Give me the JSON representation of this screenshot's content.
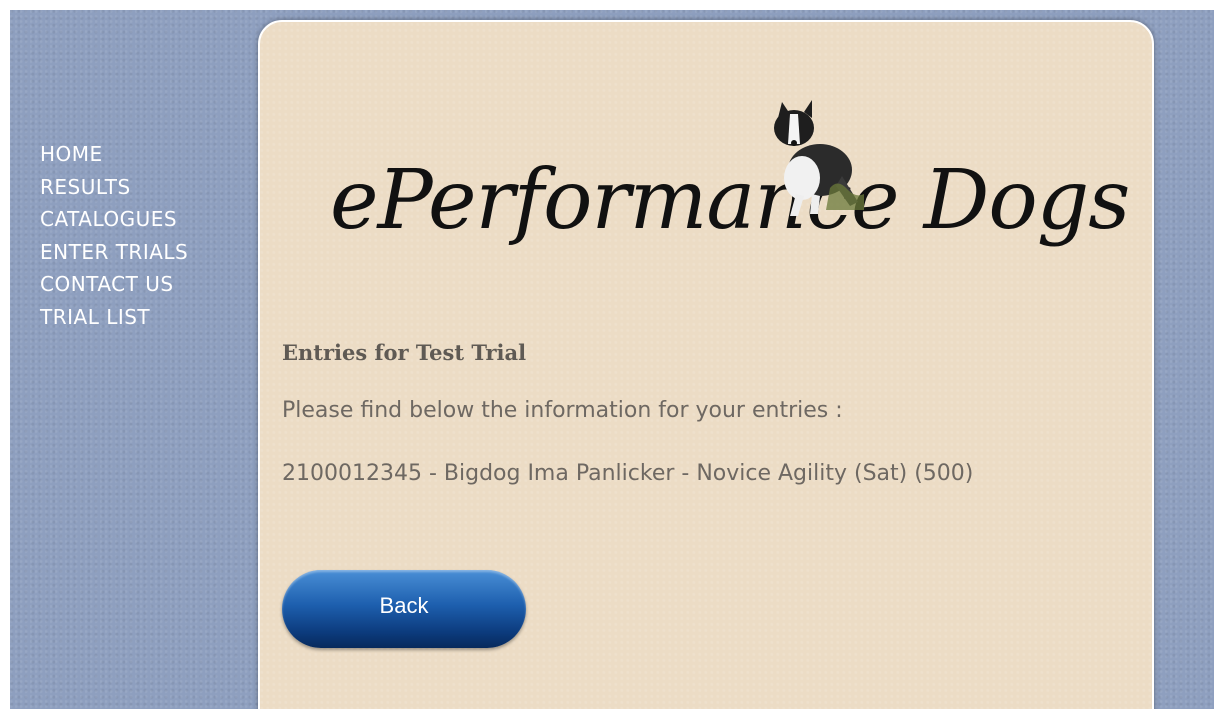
{
  "nav": {
    "items": [
      {
        "label": "HOME"
      },
      {
        "label": "RESULTS"
      },
      {
        "label": "CATALOGUES"
      },
      {
        "label": "ENTER TRIALS"
      },
      {
        "label": "CONTACT US"
      },
      {
        "label": "TRIAL LIST"
      }
    ]
  },
  "logo": {
    "text": "ePerformance Dogs"
  },
  "content": {
    "heading": "Entries for Test Trial",
    "intro": "Please find below the information for your entries :",
    "entry": "2100012345 - Bigdog Ima Panlicker - Novice Agility (Sat) (500)"
  },
  "buttons": {
    "back_label": "Back"
  },
  "colors": {
    "background": "#8e9fbf",
    "panel": "#ecdcc5",
    "text": "#6e6862",
    "heading": "#5f5a54",
    "button": "#1d5fae"
  }
}
